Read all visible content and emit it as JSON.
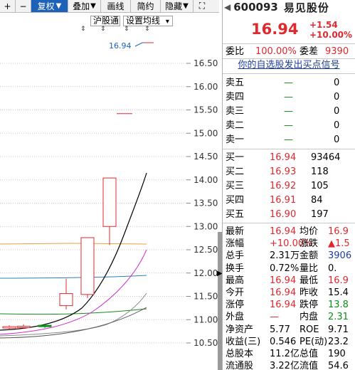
{
  "toolbar": {
    "plus": "+",
    "minus": "−",
    "adjust": "复权",
    "adjust_arrow": "▼",
    "overlay": "叠加",
    "overlay_arrow": "▼",
    "draw": "画线",
    "simple": "简约",
    "hide": "隐藏",
    "hide_arrow": "▼",
    "expand": "⛶"
  },
  "chart_top": {
    "connect_label": "沪股通",
    "ma_settings": "设置均线",
    "ma_arrow": "▾",
    "price_marker": "16.94"
  },
  "y_axis": [
    "16.50",
    "16.00",
    "15.50",
    "15.00",
    "14.50",
    "14.00",
    "13.50",
    "13.00",
    "12.50",
    "12.00",
    "11.50",
    "11.00",
    "10.50"
  ],
  "chart_data": {
    "type": "candlestick",
    "y_range": [
      10.3,
      16.8
    ],
    "ticks": [
      16.5,
      16.0,
      15.5,
      15.0,
      14.5,
      14.0,
      13.5,
      13.0,
      12.5,
      12.0,
      11.5,
      11.0,
      10.5
    ],
    "candles": [
      {
        "open": 10.85,
        "close": 10.82,
        "high": 10.88,
        "low": 10.78,
        "color": "red"
      },
      {
        "open": 10.84,
        "close": 10.86,
        "high": 10.9,
        "low": 10.8,
        "color": "red"
      },
      {
        "open": 10.88,
        "close": 10.85,
        "high": 10.9,
        "low": 10.82,
        "color": "green"
      },
      {
        "open": 11.3,
        "close": 11.56,
        "high": 11.88,
        "low": 11.22,
        "color": "red"
      },
      {
        "open": 11.54,
        "close": 12.76,
        "high": 12.76,
        "low": 11.46,
        "color": "red"
      },
      {
        "open": 13.0,
        "close": 14.04,
        "high": 14.04,
        "low": 12.6,
        "color": "red"
      }
    ],
    "limit_marker": 15.42
  },
  "quote": {
    "code": "600093",
    "name": "易见股份",
    "price": "16.94",
    "change": "+1.54",
    "change_pct": "+10.00%",
    "weibi_label": "委比",
    "weibi": "100.00%",
    "weicha_label": "委差",
    "weicha": "9390",
    "signal_text": "你的自选股发出买点信号",
    "sells": [
      {
        "label": "卖五",
        "price": "—",
        "vol": "0"
      },
      {
        "label": "卖四",
        "price": "—",
        "vol": "0"
      },
      {
        "label": "卖三",
        "price": "—",
        "vol": "0"
      },
      {
        "label": "卖二",
        "price": "—",
        "vol": "0"
      },
      {
        "label": "卖一",
        "price": "—",
        "vol": "0"
      }
    ],
    "buys": [
      {
        "label": "买一",
        "price": "16.94",
        "vol": "93464"
      },
      {
        "label": "买二",
        "price": "16.93",
        "vol": "118"
      },
      {
        "label": "买三",
        "price": "16.92",
        "vol": "105"
      },
      {
        "label": "买四",
        "price": "16.91",
        "vol": "84"
      },
      {
        "label": "买五",
        "price": "16.90",
        "vol": "197"
      }
    ],
    "stats": [
      {
        "l1": "最新",
        "v1": "16.94",
        "c1": "red",
        "l2": "均价",
        "v2": "16.9",
        "c2": "red"
      },
      {
        "l1": "涨幅",
        "v1": "+10.00%",
        "c1": "red",
        "l2": "涨跌",
        "v2": "▲1.5",
        "c2": "red"
      },
      {
        "l1": "总手",
        "v1": "2.31万",
        "c1": "",
        "l2": "金额",
        "v2": "3906",
        "c2": "blue"
      },
      {
        "l1": "换手",
        "v1": "0.72%",
        "c1": "",
        "l2": "量比",
        "v2": "0.",
        "c2": ""
      },
      {
        "l1": "最高",
        "v1": "16.94",
        "c1": "red",
        "l2": "最低",
        "v2": "16.9",
        "c2": "red"
      },
      {
        "l1": "今开",
        "v1": "16.94",
        "c1": "red",
        "l2": "昨收",
        "v2": "15.4",
        "c2": ""
      },
      {
        "l1": "涨停",
        "v1": "16.94",
        "c1": "red",
        "l2": "跌停",
        "v2": "13.8",
        "c2": "green"
      },
      {
        "l1": "外盘",
        "v1": "—",
        "c1": "red",
        "l2": "内盘",
        "v2": "2.31",
        "c2": "green"
      },
      {
        "l1": "净资产",
        "v1": "5.77",
        "c1": "",
        "l2": "ROE",
        "v2": "9.71",
        "c2": ""
      },
      {
        "l1": "收益(三)",
        "v1": "0.546",
        "c1": "",
        "l2": "PE(动)",
        "v2": "23.2",
        "c2": ""
      },
      {
        "l1": "总股本",
        "v1": "11.2亿",
        "c1": "",
        "l2": "总值",
        "v2": "190",
        "c2": ""
      },
      {
        "l1": "流通股",
        "v1": "3.22亿",
        "c1": "",
        "l2": "流值",
        "v2": "54.6",
        "c2": ""
      }
    ]
  },
  "colors": {
    "up": "#e0282e",
    "down": "#0a8f1a",
    "accent": "#1c62b9",
    "ma5": "#000000",
    "ma10": "#cc33cc",
    "ma20": "#8a8a8a",
    "ma30": "#1a8a1a",
    "ma60": "#2a7fb8",
    "ma120": "#e6a23c"
  }
}
